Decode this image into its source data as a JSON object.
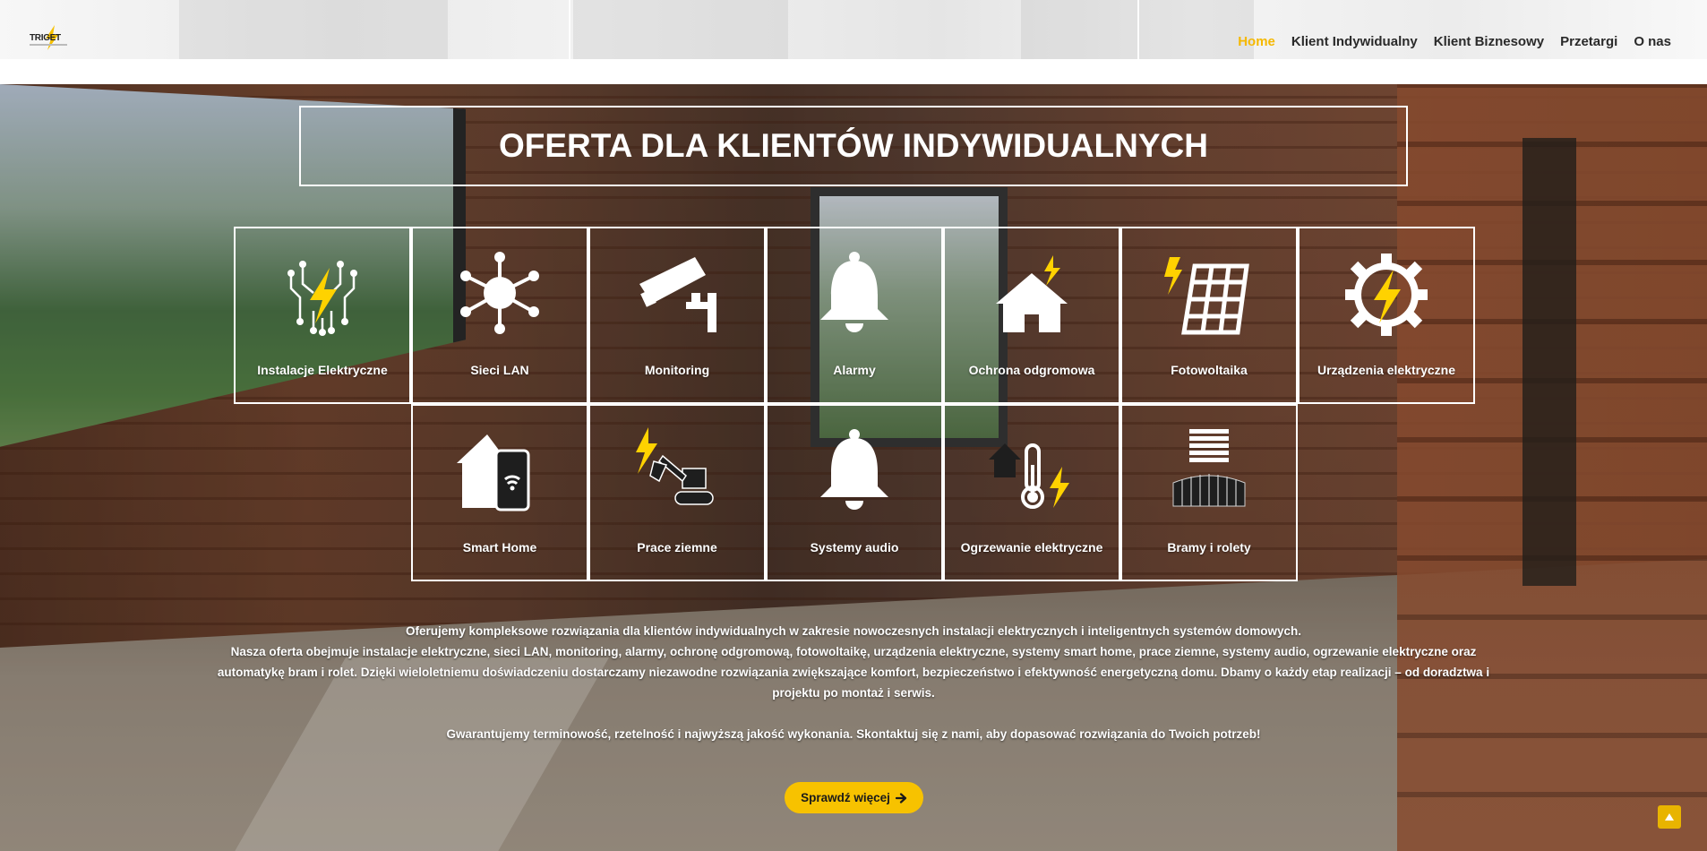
{
  "brand": {
    "logo_text": "TRIGET",
    "accent": "#f5b800"
  },
  "nav": {
    "items": [
      {
        "label": "Home",
        "active": true
      },
      {
        "label": "Klient Indywidualny",
        "active": false
      },
      {
        "label": "Klient Biznesowy",
        "active": false
      },
      {
        "label": "Przetargi",
        "active": false
      },
      {
        "label": "O nas",
        "active": false
      }
    ]
  },
  "hero": {
    "title": "OFERTA DLA KLIENTÓW INDYWIDUALNYCH",
    "services_row1": [
      {
        "label": "Instalacje Elektryczne",
        "icon": "circuit-bolt-icon"
      },
      {
        "label": "Sieci LAN",
        "icon": "network-hub-icon"
      },
      {
        "label": "Monitoring",
        "icon": "security-camera-icon"
      },
      {
        "label": "Alarmy",
        "icon": "bell-icon"
      },
      {
        "label": "Ochrona odgromowa",
        "icon": "house-lightning-icon"
      },
      {
        "label": "Fotowoltaika",
        "icon": "solar-panel-icon"
      },
      {
        "label": "Urządzenia elektryczne",
        "icon": "gear-bolt-icon"
      }
    ],
    "services_row2": [
      {
        "label": "Smart Home",
        "icon": "smart-home-phone-icon"
      },
      {
        "label": "Prace ziemne",
        "icon": "excavator-icon"
      },
      {
        "label": "Systemy audio",
        "icon": "bell-icon"
      },
      {
        "label": "Ogrzewanie elektryczne",
        "icon": "thermometer-house-icon"
      },
      {
        "label": "Bramy i rolety",
        "icon": "gate-blinds-icon"
      }
    ],
    "description": {
      "p1": "Oferujemy kompleksowe rozwiązania dla klientów indywidualnych w zakresie nowoczesnych instalacji elektrycznych i inteligentnych systemów domowych.\nNasza oferta obejmuje instalacje elektryczne, sieci LAN, monitoring, alarmy, ochronę odgromową, fotowoltaikę, urządzenia elektryczne, systemy smart home, prace ziemne, systemy audio, ogrzewanie elektryczne oraz automatykę bram i rolet. Dzięki wieloletniemu doświadczeniu dostarczamy niezawodne rozwiązania zwiększające komfort, bezpieczeństwo i efektywność energetyczną domu. Dbamy o każdy etap realizacji – od doradztwa i projektu po montaż i serwis.",
      "p2": "Gwarantujemy terminowość, rzetelność i najwyższą jakość wykonania. Skontaktuj się z nami, aby dopasować rozwiązania do Twoich potrzeb!"
    },
    "cta_label": "Sprawdź więcej",
    "cta_icon": "arrow-right-icon"
  },
  "colors": {
    "cta_bg": "#f7c200",
    "tile_border": "#ffffff",
    "bolt": "#ffd200"
  }
}
